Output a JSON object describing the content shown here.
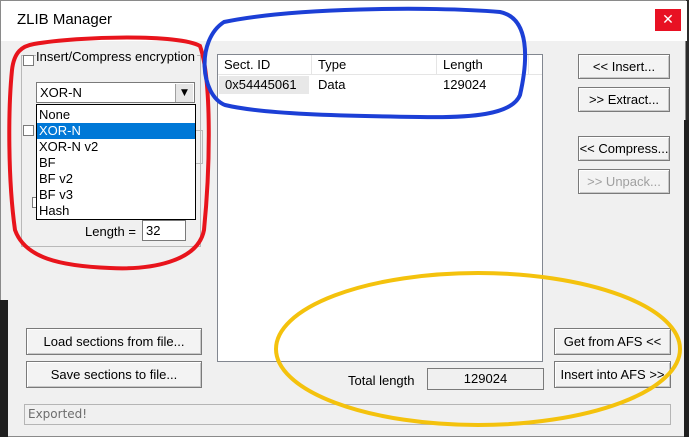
{
  "window": {
    "title": "ZLIB Manager",
    "close_glyph": "✕"
  },
  "encryption": {
    "checkbox_label": "Insert/Compress encryption",
    "selected": "XOR-N",
    "options": [
      "None",
      "XOR-N",
      "XOR-N v2",
      "BF",
      "BF v2",
      "BF v3",
      "Hash"
    ],
    "selected_index": 1,
    "length_label": "Length =",
    "length_value": "32"
  },
  "sections": {
    "columns": [
      "Sect. ID",
      "Type",
      "Length"
    ],
    "rows": [
      {
        "id": "0x54445061",
        "type": "Data",
        "length": "129024"
      }
    ]
  },
  "buttons": {
    "insert": "<< Insert...",
    "extract": ">> Extract...",
    "compress": "<< Compress...",
    "unpack": ">> Unpack...",
    "load": "Load sections from file...",
    "save": "Save sections to file...",
    "get_afs": "Get from AFS <<",
    "insert_afs": "Insert into AFS >>"
  },
  "total": {
    "label": "Total length",
    "value": "129024"
  },
  "status": {
    "text": "Exported!"
  },
  "colors": {
    "annotation_red": "#e8141c",
    "annotation_blue": "#1c3fd6",
    "annotation_yellow": "#f4c20d",
    "selection": "#0078d7"
  }
}
